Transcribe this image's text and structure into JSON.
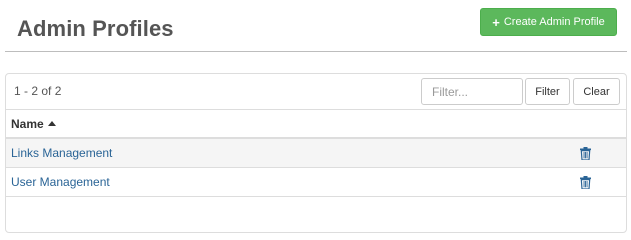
{
  "header": {
    "title": "Admin Profiles",
    "create_button_label": "Create Admin Profile",
    "create_button_icon": "plus-icon",
    "create_button_color": "#5cb85c"
  },
  "toolbar": {
    "count_text": "1 - 2 of 2",
    "filter_placeholder": "Filter...",
    "filter_value": "",
    "filter_button_label": "Filter",
    "clear_button_label": "Clear"
  },
  "table": {
    "columns": [
      {
        "label": "Name",
        "sort": "ascending",
        "sort_icon": "sort-asc-icon"
      }
    ],
    "rows": [
      {
        "name": "Links Management",
        "action_icon": "trash-icon"
      },
      {
        "name": "User Management",
        "action_icon": "trash-icon"
      }
    ],
    "link_color": "#2a6496",
    "icon_color": "#2a6496"
  }
}
